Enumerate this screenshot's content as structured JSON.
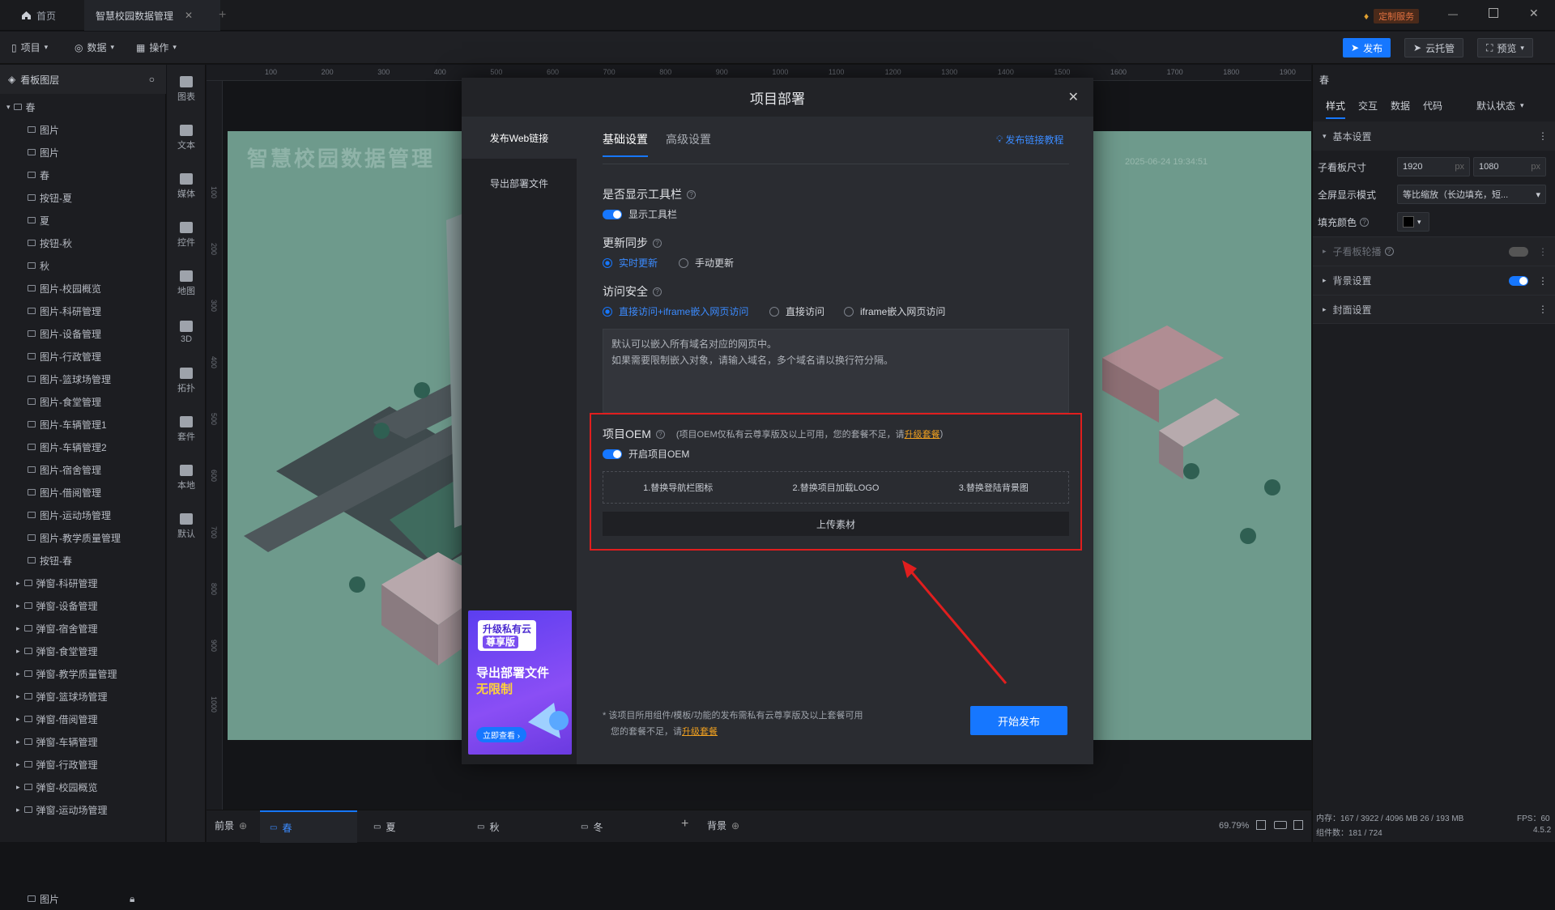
{
  "titlebar": {
    "home_tab": "首页",
    "project_tab": "智慧校园数据管理",
    "custom_service": "定制服务",
    "new_tab_icon": "plus-icon"
  },
  "toolbar": {
    "menu_project": "项目",
    "menu_data": "数据",
    "menu_operate": "操作",
    "publish": "发布",
    "cloud_host": "云托管",
    "preview": "预览"
  },
  "layers": {
    "title": "看板图层",
    "root": "春",
    "items": [
      "图片",
      "图片",
      "春",
      "按钮-夏",
      "夏",
      "按钮-秋",
      "秋",
      "图片-校园概览",
      "图片-科研管理",
      "图片-设备管理",
      "图片-行政管理",
      "图片-篮球场管理",
      "图片-食堂管理",
      "图片-车辆管理1",
      "图片-车辆管理2",
      "图片-宿舍管理",
      "图片-借阅管理",
      "图片-运动场管理",
      "图片-教学质量管理",
      "按钮-春"
    ],
    "groups": [
      "弹窗-科研管理",
      "弹窗-设备管理",
      "弹窗-宿舍管理",
      "弹窗-食堂管理",
      "弹窗-教学质量管理",
      "弹窗-篮球场管理",
      "弹窗-借阅管理",
      "弹窗-车辆管理",
      "弹窗-行政管理",
      "弹窗-校园概览",
      "弹窗-运动场管理"
    ],
    "last_item": "图片"
  },
  "components": [
    "图表",
    "文本",
    "媒体",
    "控件",
    "地图",
    "3D",
    "拓扑",
    "套件",
    "本地",
    "默认"
  ],
  "canvas": {
    "ruler_ticks": [
      "100",
      "200",
      "300",
      "400",
      "500",
      "600",
      "700",
      "800",
      "900",
      "1000",
      "1100",
      "1200",
      "1300",
      "1400",
      "1500",
      "1600",
      "1700",
      "1800",
      "1900"
    ],
    "vruler_ticks": [
      "100",
      "200",
      "300",
      "400",
      "500",
      "600",
      "700",
      "800",
      "900",
      "1000"
    ],
    "stage_title": "智慧校园数据管理",
    "stage_time": "2025-06-24 19:34:51"
  },
  "bottombar": {
    "foreground": "前景",
    "pages": [
      "春",
      "夏",
      "秋",
      "冬"
    ],
    "background": "背景",
    "zoom": "69.79%"
  },
  "rightpanel": {
    "title": "春",
    "tabs": [
      "样式",
      "交互",
      "数据",
      "代码"
    ],
    "state": "默认状态",
    "basic_settings": "基本设置",
    "size_label": "子看板尺寸",
    "width": "1920",
    "height": "1080",
    "unit": "px",
    "fullscreen_label": "全屏显示模式",
    "fullscreen_value": "等比缩放（长边填充，短...",
    "fill_label": "填充颜色",
    "fill_color": "#000000",
    "sub_outline": "子看板轮播",
    "bg_settings": "背景设置",
    "cover_settings": "封面设置",
    "memory": "内存：167 / 3922 / 4096 MB  26 / 193 MB",
    "fps": "FPS：60",
    "components_count": "组件数：181 / 724",
    "version": "4.5.2"
  },
  "modal": {
    "title": "项目部署",
    "side": [
      "发布Web链接",
      "导出部署文件"
    ],
    "tabs": [
      "基础设置",
      "高级设置"
    ],
    "tutorial": "发布链接教程",
    "toolbar_label": "是否显示工具栏",
    "toolbar_toggle": "显示工具栏",
    "sync_label": "更新同步",
    "sync_options": [
      "实时更新",
      "手动更新"
    ],
    "security_label": "访问安全",
    "security_options": [
      "直接访问+iframe嵌入网页访问",
      "直接访问",
      "iframe嵌入网页访问"
    ],
    "domain_hint_1": "默认可以嵌入所有域名对应的网页中。",
    "domain_hint_2": "如果需要限制嵌入对象，请输入域名，多个域名请以换行符分隔。",
    "oem_label": "项目OEM",
    "oem_note": "(项目OEM仅私有云尊享版及以上可用，您的套餐不足，请",
    "oem_note_link": "升级套餐",
    "oem_note_end": ")",
    "oem_toggle": "开启项目OEM",
    "oem_steps": [
      "1.替换导航栏图标",
      "2.替换项目加载LOGO",
      "3.替换登陆背景图"
    ],
    "upload": "上传素材",
    "footer_note_1": "* 该项目所用组件/模板/功能的发布需私有云尊享版及以上套餐可用",
    "footer_note_2": "您的套餐不足，请",
    "footer_note_link": "升级套餐",
    "publish_btn": "开始发布",
    "promo_line1": "升级私有云",
    "promo_line2": "尊享版",
    "promo_line3": "导出部署文件",
    "promo_line4": "无限制",
    "promo_btn": "立即查看"
  },
  "colors": {
    "accent": "#1677ff",
    "highlight": "#e01e1e",
    "link": "#f0a020"
  }
}
